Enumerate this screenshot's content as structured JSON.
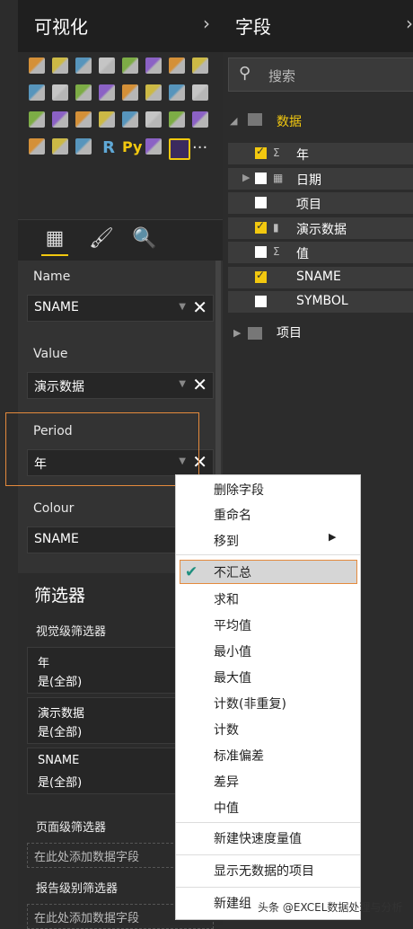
{
  "viz_panel": {
    "title": "可视化",
    "chevron": "›"
  },
  "viz_icons": [
    "stacked-bar",
    "stacked-column",
    "clustered-bar",
    "clustered-column",
    "100-bar",
    "100-column",
    "line",
    "area",
    "stacked-area",
    "line-column",
    "line-column-2",
    "ribbon",
    "waterfall",
    "scatter",
    "pie",
    "donut",
    "treemap",
    "map",
    "filled-map",
    "funnel",
    "gauge",
    "card",
    "multi-row-card",
    "kpi",
    "slicer",
    "table",
    "matrix",
    "R",
    "Py",
    "globe",
    "custom-visual",
    "more"
  ],
  "viz_special": {
    "r": "R",
    "py": "Py",
    "more": "···"
  },
  "wells": {
    "name_label": "Name",
    "name_value": "SNAME",
    "value_label": "Value",
    "value_value": "演示数据",
    "period_label": "Period",
    "period_value": "年",
    "colour_label": "Colour",
    "colour_value": "SNAME",
    "remove": "✕"
  },
  "filters": {
    "title": "筛选器",
    "visual_level": "视觉级筛选器",
    "cards": [
      {
        "field": "年",
        "state": "是(全部)"
      },
      {
        "field": "演示数据",
        "state": "是(全部)"
      },
      {
        "field": "SNAME",
        "state": "是(全部)"
      }
    ],
    "page_level": "页面级筛选器",
    "page_add": "在此处添加数据字段",
    "report_level": "报告级别筛选器",
    "report_add": "在此处添加数据字段"
  },
  "fields_panel": {
    "title": "字段",
    "chevron": "›",
    "search_placeholder": "搜索",
    "table1": "数据",
    "rows": [
      {
        "label": "年",
        "checked": true
      },
      {
        "label": "日期",
        "checked": false
      },
      {
        "label": "项目",
        "checked": false
      },
      {
        "label": "演示数据",
        "checked": true
      },
      {
        "label": "值",
        "checked": false
      },
      {
        "label": "SNAME",
        "checked": true
      },
      {
        "label": "SYMBOL",
        "checked": false
      }
    ],
    "table2": "项目"
  },
  "menu": {
    "items": [
      "删除字段",
      "重命名",
      "移到",
      "不汇总",
      "求和",
      "平均值",
      "最小值",
      "最大值",
      "计数(非重复)",
      "计数",
      "标准偏差",
      "差异",
      "中值",
      "新建快速度量值",
      "显示无数据的项目",
      "新建组"
    ],
    "selected": "不汇总"
  },
  "watermark": "头条 @EXCEL数据处理与分析",
  "colors": {
    "accent": "#f2c80f",
    "highlight_border": "#e58a3c",
    "check": "#1e8f7e"
  }
}
